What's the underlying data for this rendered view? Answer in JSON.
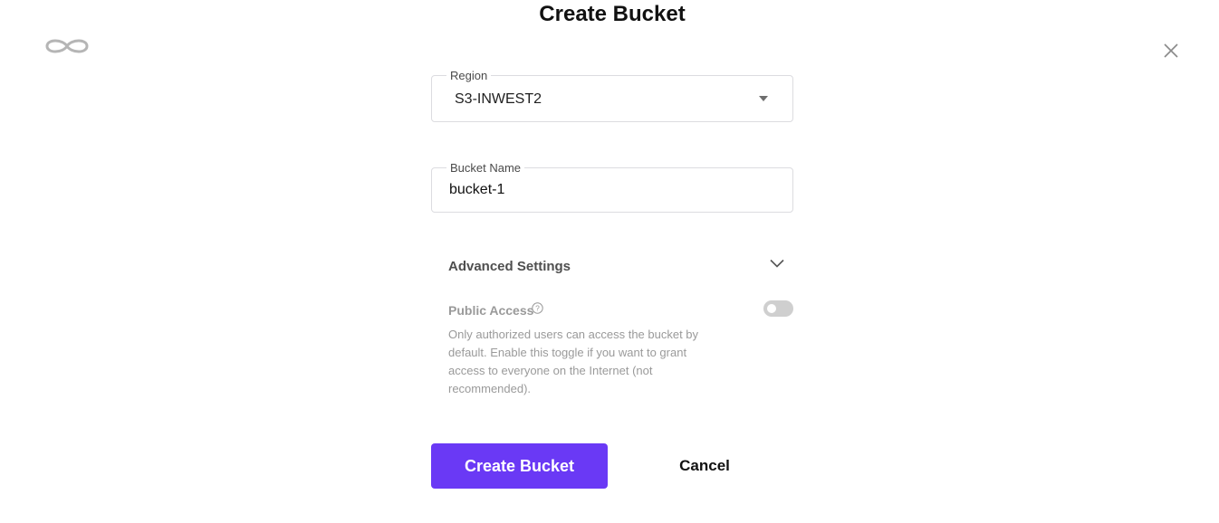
{
  "dialog": {
    "title": "Create Bucket",
    "logo_icon": "infinity-logo-icon",
    "close_icon": "close-icon"
  },
  "region": {
    "label": "Region",
    "value": "S3-INWEST2"
  },
  "bucket_name": {
    "label": "Bucket Name",
    "value": "bucket-1"
  },
  "advanced": {
    "label": "Advanced Settings",
    "expanded": true,
    "public_access": {
      "label": "Public Access",
      "enabled": false,
      "description": "Only authorized users can access the bucket by default. Enable this toggle if you want to grant access to everyone on the Internet (not recommended)."
    }
  },
  "actions": {
    "create_label": "Create Bucket",
    "cancel_label": "Cancel"
  },
  "colors": {
    "primary": "#6a39f5",
    "toggle_off": "#cfcfcf",
    "muted_text": "#9a9a9a"
  }
}
